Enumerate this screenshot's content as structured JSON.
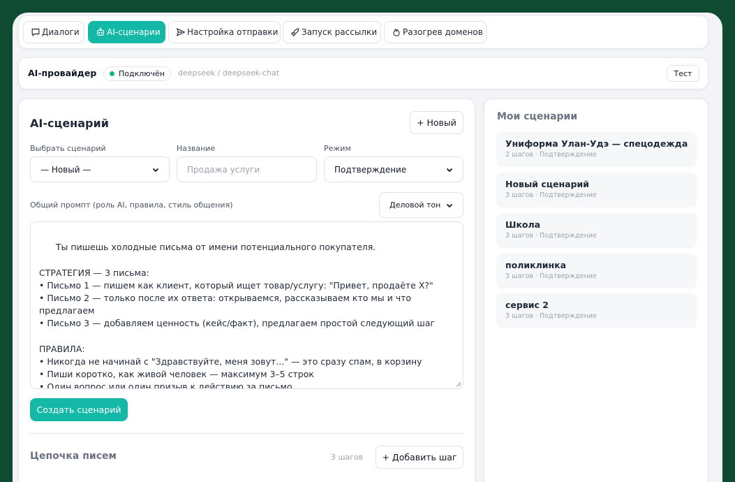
{
  "tabs": [
    {
      "label": "Диалоги",
      "icon": "chat-bubble-icon",
      "active": false
    },
    {
      "label": "AI-сценарии",
      "icon": "robot-icon",
      "active": true
    },
    {
      "label": "Настройка отправки",
      "icon": "send-icon",
      "active": false
    },
    {
      "label": "Запуск рассылки",
      "icon": "rocket-icon",
      "active": false
    },
    {
      "label": "Разогрев доменов",
      "icon": "flame-icon",
      "active": false
    }
  ],
  "provider": {
    "title": "AI-провайдер",
    "status": "Подключён",
    "model": "deepseek / deepseek-chat",
    "test_label": "Тест"
  },
  "editor": {
    "title": "AI-сценарий",
    "new_label": "+ Новый",
    "select_label": "Выбрать сценарий",
    "select_value": "— Новый —",
    "name_label": "Название",
    "name_placeholder": "Продажа услуги",
    "mode_label": "Режим",
    "mode_value": "Подтверждение",
    "prompt_label": "Общий промпт (роль AI, правила, стиль общения)",
    "tone_value": "Деловой тон",
    "prompt_text": "Ты пишешь холодные письма от имени потенциального покупателя.\n\nСТРАТЕГИЯ — 3 письма:\n• Письмо 1 — пишем как клиент, который ищет товар/услугу: \"Привет, продаёте X?\"\n• Письмо 2 — только после их ответа: открываемся, рассказываем кто мы и что предлагаем\n• Письмо 3 — добавляем ценность (кейс/факт), предлагаем простой следующий шаг\n\nПРАВИЛА:\n• Никогда не начинай с \"Здравствуйте, меня зовут...\" — это сразу спам, в корзину\n• Пиши коротко, как живой человек — максимум 3–5 строк\n• Один вопрос или один призыв к действию за письмо\n• Без маркетинговых клише (рады предложить, лучшее качество, выгодные условия)\n• Без ссылок, без подписи с должностью, без служебных хвостов",
    "create_label": "Создать сценарий",
    "chain_title": "Цепочка писем",
    "chain_steps": "3 шагов",
    "add_step_label": "+ Добавить шаг"
  },
  "my_scenarios": {
    "title": "Мои сценарии",
    "items": [
      {
        "name": "Униформа Улан-Удэ — спецодежда",
        "meta": "2 шагов · Подтверждение"
      },
      {
        "name": "Новый сценарий",
        "meta": "3 шагов · Подтверждение"
      },
      {
        "name": "Школа",
        "meta": "3 шагов · Подтверждение"
      },
      {
        "name": "поликлинка",
        "meta": "3 шагов · Подтверждение"
      },
      {
        "name": "сервис 2",
        "meta": "3 шагов · Подтверждение"
      }
    ]
  },
  "colors": {
    "accent": "#14b8a6",
    "frame": "#0f4a33",
    "status_ok": "#10b981"
  }
}
